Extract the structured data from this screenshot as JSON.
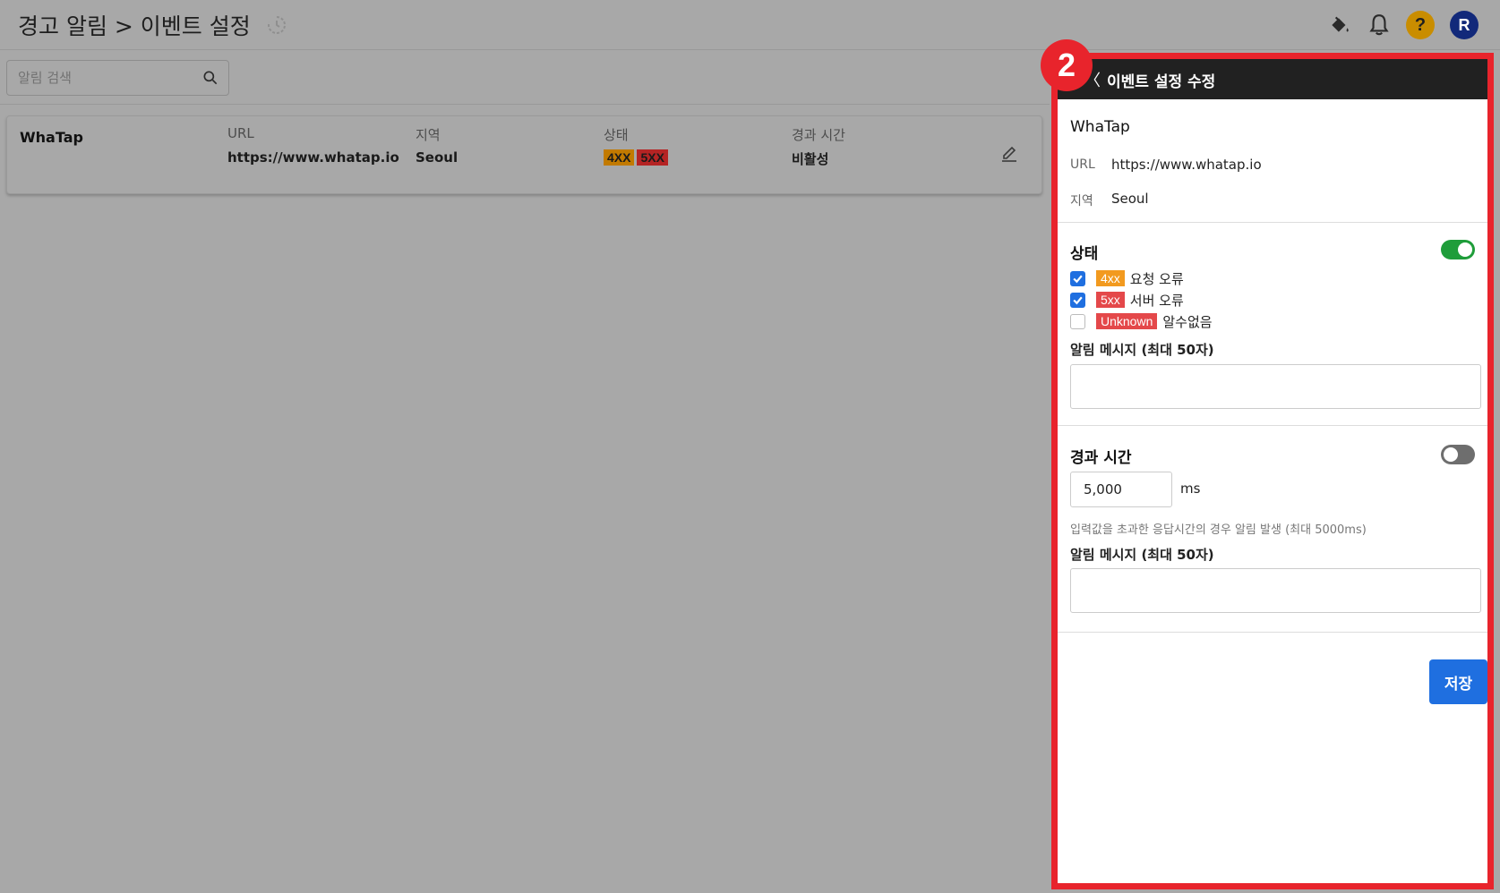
{
  "header": {
    "title": "경고 알림 > 이벤트 설정",
    "avatar_letter": "R",
    "help_glyph": "?"
  },
  "search": {
    "placeholder": "알림 검색"
  },
  "row": {
    "name": "WhaTap",
    "url_label": "URL",
    "url_value": "https://www.whatap.io",
    "region_label": "지역",
    "region_value": "Seoul",
    "status_label": "상태",
    "status_badges": [
      "4XX",
      "5XX"
    ],
    "elapsed_label": "경과 시간",
    "elapsed_value": "비활성"
  },
  "panel": {
    "step_number": "2",
    "back_glyph": "〈",
    "title": "이벤트 설정 수정",
    "name": "WhaTap",
    "url_label": "URL",
    "url_value": "https://www.whatap.io",
    "region_label": "지역",
    "region_value": "Seoul",
    "status": {
      "title": "상태",
      "enabled": true,
      "options": [
        {
          "badge": "4xx",
          "label": "요청 오류",
          "checked": true
        },
        {
          "badge": "5xx",
          "label": "서버 오류",
          "checked": true
        },
        {
          "badge": "Unknown",
          "label": "알수없음",
          "checked": false
        }
      ],
      "message_label": "알림 메시지 (최대 50자)",
      "message_value": ""
    },
    "elapsed": {
      "title": "경과 시간",
      "enabled": false,
      "value": "5,000",
      "unit": "ms",
      "help": "입력값을 초과한 응답시간의 경우 알림 발생 (최대 5000ms)",
      "message_label": "알림 메시지 (최대 50자)",
      "message_value": ""
    },
    "save_label": "저장"
  },
  "colors": {
    "overlay": "#a8a8a8",
    "highlight_border": "#e8242c",
    "toggle_on": "#1f9d3a",
    "primary": "#1f6fe0"
  }
}
